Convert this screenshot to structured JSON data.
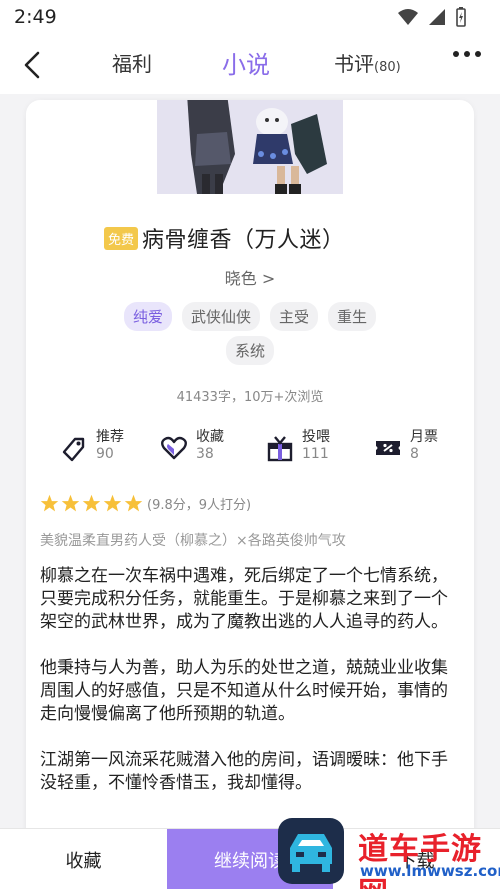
{
  "status": {
    "time": "2:49"
  },
  "header": {
    "tabs": {
      "welfare": "福利",
      "novel": "小说",
      "review": "书评",
      "review_count": "(80)"
    }
  },
  "book": {
    "free_badge": "免费",
    "title": "病骨缠香（万人迷）",
    "author": "晓色 >",
    "tags_row1": [
      "纯爱",
      "武侠仙侠",
      "主受",
      "重生"
    ],
    "tags_row2": [
      "系统"
    ],
    "stats": "41433字，10万+次浏览",
    "rating_text": "(9.8分，9人打分)",
    "subtitle": "美貌温柔直男药人受（柳慕之）×各路英俊帅气攻",
    "description": [
      "柳慕之在一次车祸中遇难，死后绑定了一个七情系统，只要完成积分任务，就能重生。于是柳慕之来到了一个架空的武林世界，成为了魔教出逃的人人追寻的药人。",
      "他秉持与人为善，助人为乐的处世之道，兢兢业业收集周围人的好感值，只是不知道从什么时候开始，事情的走向慢慢偏离了他所预期的轨道。",
      "江湖第一风流采花贼潜入他的房间，语调暧昧：他下手没轻重，不懂怜香惜玉，我却懂得。"
    ]
  },
  "actions": [
    {
      "label": "推荐",
      "count": "90",
      "icon": "recommend-icon"
    },
    {
      "label": "收藏",
      "count": "38",
      "icon": "heart-icon"
    },
    {
      "label": "投喂",
      "count": "111",
      "icon": "gift-icon"
    },
    {
      "label": "月票",
      "count": "8",
      "icon": "ticket-icon"
    }
  ],
  "bottom": {
    "collect": "收藏",
    "continue": "继续阅读",
    "download": "下载"
  },
  "watermark": {
    "text": "道车手游网",
    "url": "www.lmwwsz.com"
  },
  "colors": {
    "accent": "#9b7ff0",
    "star": "#f7c03a",
    "free": "#f3c84b"
  }
}
